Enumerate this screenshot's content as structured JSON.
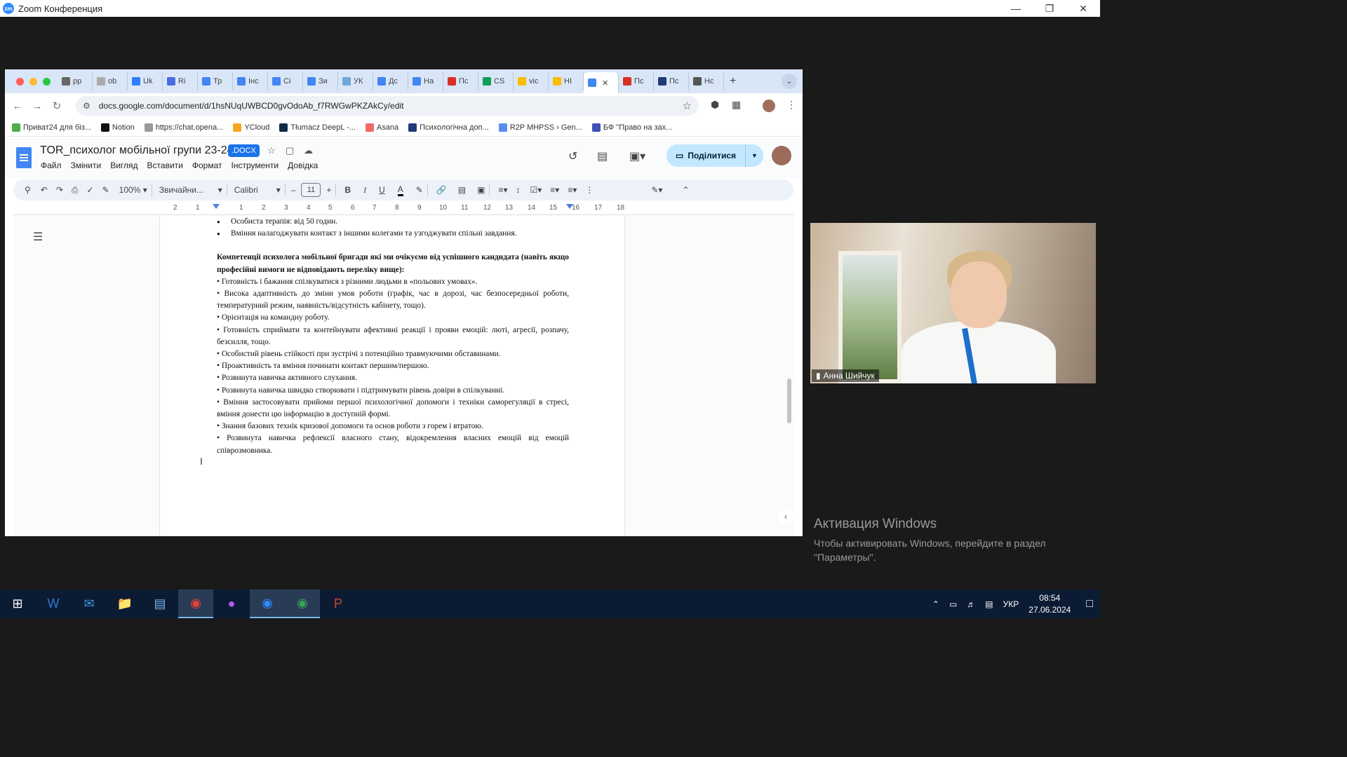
{
  "zoom": {
    "title": "Zoom Конференция",
    "logo": "zm"
  },
  "browser": {
    "tabs": [
      {
        "label": "рр",
        "color": "#666"
      },
      {
        "label": "ob",
        "color": "#aaa"
      },
      {
        "label": "Uk",
        "color": "#2d7ff9"
      },
      {
        "label": "Ri",
        "color": "#4a6ee0"
      },
      {
        "label": "Тр",
        "color": "#4285f4"
      },
      {
        "label": "Інс",
        "color": "#4285f4"
      },
      {
        "label": "Сі",
        "color": "#4285f4"
      },
      {
        "label": "Зи",
        "color": "#4285f4"
      },
      {
        "label": "УК",
        "color": "#6fa8dc"
      },
      {
        "label": "Дс",
        "color": "#4285f4"
      },
      {
        "label": "На",
        "color": "#4285f4"
      },
      {
        "label": "Пс",
        "color": "#d93025"
      },
      {
        "label": "CS",
        "color": "#0f9d58"
      },
      {
        "label": "vic",
        "color": "#fbbc04"
      },
      {
        "label": "НІ",
        "color": "#fbbc04"
      },
      {
        "label": "",
        "color": "#4285f4",
        "active": true
      },
      {
        "label": "Пс",
        "color": "#d93025"
      },
      {
        "label": "Пс",
        "color": "#203a7a"
      },
      {
        "label": "Нс",
        "color": "#555"
      }
    ],
    "url": "docs.google.com/document/d/1hsNUqUWBCD0gvOdoAb_f7RWGwPKZAkCy/edit",
    "bookmarks": [
      {
        "label": "Приват24 для біз...",
        "color": "#4caf50"
      },
      {
        "label": "Notion",
        "color": "#111"
      },
      {
        "label": "https://chat.opena...",
        "color": "#999"
      },
      {
        "label": "YCloud",
        "color": "#f5a623"
      },
      {
        "label": "Tłumacz DeepL -...",
        "color": "#0f2b46"
      },
      {
        "label": "Asana",
        "color": "#f06a6a"
      },
      {
        "label": "Психологічна доп...",
        "color": "#203a7a"
      },
      {
        "label": "R2P MHPSS › Gen...",
        "color": "#5b8def"
      },
      {
        "label": "БФ \"Право на зах...",
        "color": "#3f51b5"
      }
    ]
  },
  "docs": {
    "title": "TOR_психолог мобільної групи 23-24",
    "badge": ".DOCX",
    "menu": [
      "Файл",
      "Змінити",
      "Вигляд",
      "Вставити",
      "Формат",
      "Інструменти",
      "Довідка"
    ],
    "share_label": "Поділитися",
    "toolbar": {
      "zoom": "100%",
      "style": "Звичайни...",
      "font": "Calibri",
      "size": "11"
    },
    "ruler": [
      "2",
      "1",
      "1",
      "2",
      "3",
      "4",
      "5",
      "6",
      "7",
      "8",
      "9",
      "10",
      "11",
      "12",
      "13",
      "14",
      "15",
      "16",
      "17",
      "18"
    ],
    "body": {
      "bullets_top": [
        "Особиста терапія: від 50 годин.",
        "Вміння налагоджувати контакт з іншими колегами та узгоджувати спільні завдання."
      ],
      "heading": "Компетенції психолога мобільної бригади які ми очікуємо від успішного кандидата (навіть якщо професійні вимоги не відповідають переліку вище):",
      "items": [
        "• Готовність і бажання спілкуватися з різними людьми в «польових умовах».",
        "• Висока адаптивність до зміни умов роботи (графік, час в дорозі, час безпосередньої роботи, температурний режим, наявність/відсутність кабінету, тощо).",
        "• Орієнтація на командну роботу.",
        "• Готовність  сприймати та контейнувати афективні реакції і прояви емоцій: люті, агресії, розпачу, безсилля, тощо.",
        "• Особистий рівень стійкості при зустрічі з потенційно травмуючими обставинами.",
        "• Проактивність та вміння починати контакт першим/першою.",
        "• Розвинута навичка активного слухання.",
        "• Розвинута навичка швидко створювати і підтримувати рівень довіри в спілкуванні.",
        "• Вміння застосовувати прийоми першої психологічної допомоги і техніки саморегуляції в стресі, вміння донести цю інформацію в доступній формі.",
        "• Знання базових технік кризової допомоги та основ роботи з горем і втратою.",
        "• Розвинута навичка рефлексії власного стану, відокремлення власних емоцій від емоцій співрозмовника."
      ]
    }
  },
  "video": {
    "participant": "Анна Шийчук"
  },
  "activation": {
    "heading": "Активация Windows",
    "line1": "Чтобы активировать Windows, перейдите в раздел",
    "line2": "\"Параметры\"."
  },
  "taskbar": {
    "lang": "УКР",
    "time": "08:54",
    "date": "27.06.2024"
  }
}
